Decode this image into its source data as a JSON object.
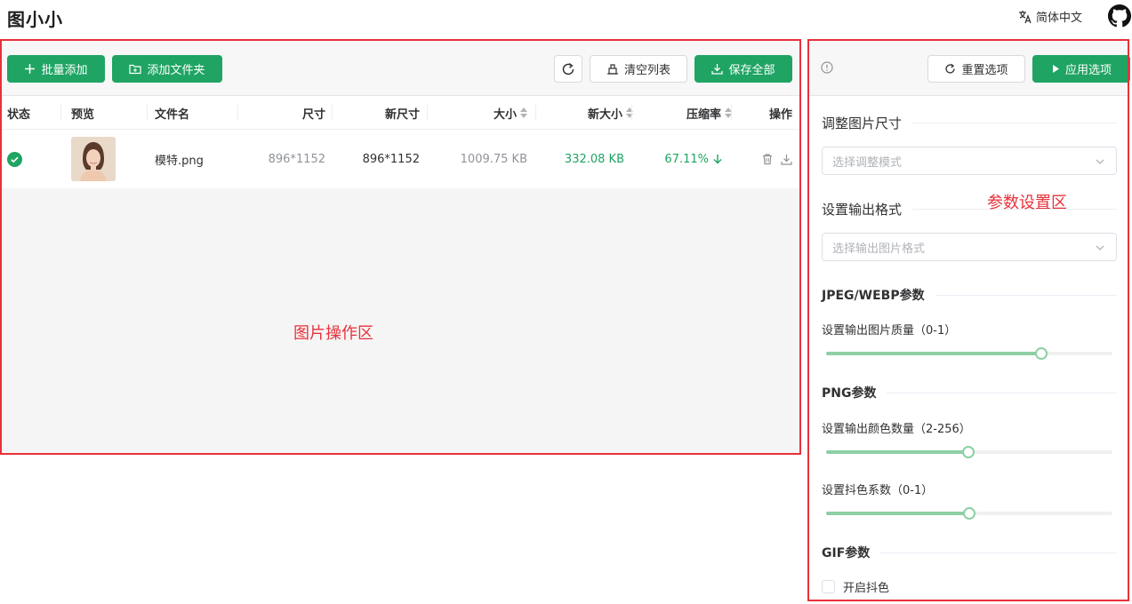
{
  "header": {
    "app_title": "图小小",
    "language_label": "简体中文"
  },
  "image_panel": {
    "toolbar": {
      "batch_add_label": "批量添加",
      "add_folder_label": "添加文件夹",
      "clear_list_label": "清空列表",
      "save_all_label": "保存全部"
    },
    "columns": {
      "status": "状态",
      "preview": "预览",
      "filename": "文件名",
      "size": "尺寸",
      "new_size": "新尺寸",
      "file_size": "大小",
      "new_file_size": "新大小",
      "ratio": "压缩率",
      "actions": "操作"
    },
    "rows": [
      {
        "filename": "模特.png",
        "size": "896*1152",
        "new_size": "896*1152",
        "file_size": "1009.75 KB",
        "new_file_size": "332.08 KB",
        "ratio": "67.11%"
      }
    ],
    "area_label": "图片操作区"
  },
  "settings_panel": {
    "reset_label": "重置选项",
    "apply_label": "应用选项",
    "resize_title": "调整图片尺寸",
    "resize_placeholder": "选择调整模式",
    "format_title": "设置输出格式",
    "format_placeholder": "选择输出图片格式",
    "jpeg_title": "JPEG/WEBP参数",
    "quality_label": "设置输出图片质量（0-1）",
    "quality_value": 0.75,
    "png_title": "PNG参数",
    "colors_label": "设置输出颜色数量（2-256）",
    "colors_value": 128,
    "dither_label": "设置抖色系数（0-1）",
    "dither_value": 0.5,
    "gif_title": "GIF参数",
    "gif_dither_label": "开启抖色",
    "gif_dither_checked": false,
    "area_label": "参数设置区"
  },
  "colors": {
    "accent": "#1fa463",
    "highlight_border": "#e8313b"
  }
}
